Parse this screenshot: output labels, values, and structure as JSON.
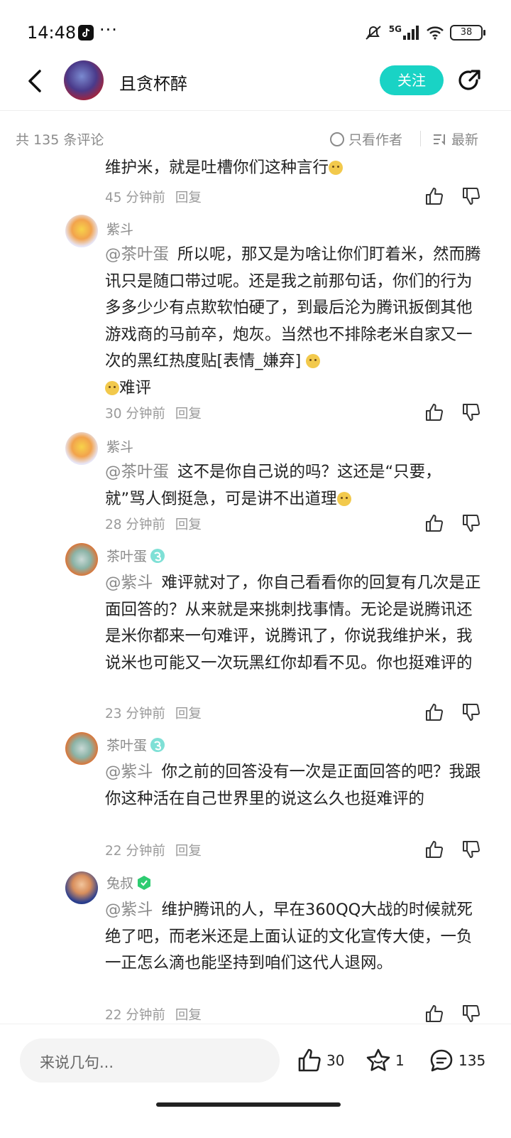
{
  "status_bar": {
    "time": "14:48",
    "network": "5G",
    "battery": "38"
  },
  "header": {
    "title": "且贪杯醉",
    "follow_label": "关注"
  },
  "comment_bar": {
    "count_text": "共 135 条评论",
    "only_author_label": "只看作者",
    "sort_label": "最新"
  },
  "comments": [
    {
      "user": "",
      "text": "维护米，就是吐槽你们这种言行",
      "time": "45 分钟前",
      "reply_label": "回复"
    },
    {
      "user": "紫斗",
      "mention": "@茶叶蛋",
      "text": "所以呢，那又是为啥让你们盯着米，然而腾讯只是随口带过呢。还是我之前那句话，你们的行为多多少少有点欺软怕硬了，到最后沦为腾讯扳倒其他游戏商的马前卒，炮灰。当然也不排除老米自家又一次的黑红热度贴[表情_嫌弃]",
      "tail": "难评",
      "time": "30 分钟前",
      "reply_label": "回复"
    },
    {
      "user": "紫斗",
      "mention": "@茶叶蛋",
      "text": "这不是你自己说的吗？这还是“只要，就”骂人倒挺急，可是讲不出道理",
      "time": "28 分钟前",
      "reply_label": "回复"
    },
    {
      "user": "茶叶蛋",
      "mention": "@紫斗",
      "text": "难评就对了，你自己看看你的回复有几次是正面回答的？从来就是来挑刺找事情。无论是说腾讯还是米你都来一句难评，说腾讯了，你说我维护米，我说米也可能又一次玩黑红你却看不见。你也挺难评的",
      "time": "23 分钟前",
      "reply_label": "回复"
    },
    {
      "user": "茶叶蛋",
      "mention": "@紫斗",
      "text": "你之前的回答没有一次是正面回答的吧？我跟你这种活在自己世界里的说这么久也挺难评的",
      "time": "22 分钟前",
      "reply_label": "回复"
    },
    {
      "user": "兔叔",
      "mention": "@紫斗",
      "text": "维护腾讯的人，早在360QQ大战的时候就死绝了吧，而老米还是上面认证的文化宣传大使，一负一正怎么滴也能坚持到咱们这代人退网。",
      "time": "22 分钟前",
      "reply_label": "回复"
    }
  ],
  "bottom_bar": {
    "input_placeholder": "来说几句...",
    "likes": "30",
    "favorites": "1",
    "comments": "135"
  },
  "colors": {
    "accent": "#19d3c5",
    "muted_text": "#8a8a8a"
  }
}
